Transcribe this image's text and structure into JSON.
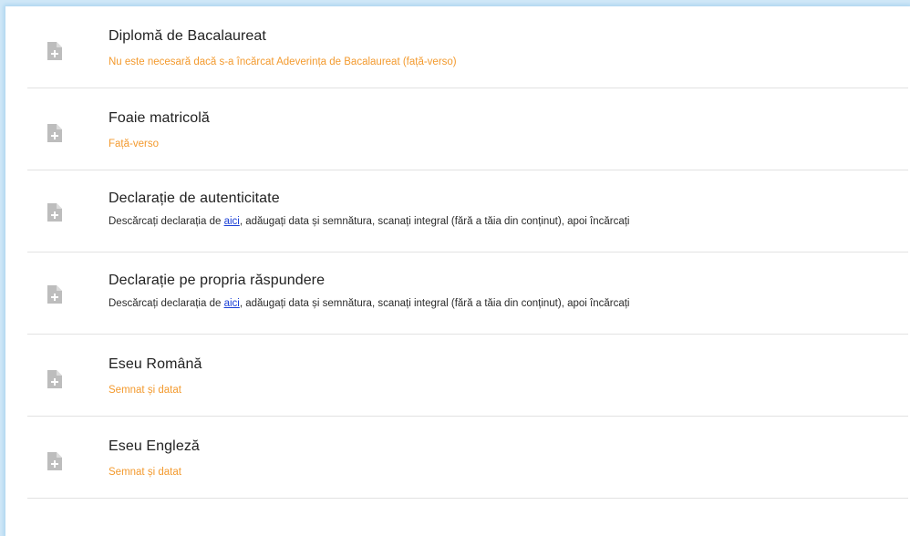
{
  "documents": [
    {
      "title": "Diplomă de Bacalaureat",
      "subtitle": "Nu este necesară dacă s-a încărcat Adeverința de Bacalaureat (față-verso)",
      "subtitle_color": "#f39a2e",
      "icon": "file-add-icon"
    },
    {
      "title": "Foaie matricolă",
      "subtitle": "Față-verso",
      "subtitle_color": "#f39a2e",
      "icon": "file-add-icon"
    },
    {
      "title": "Declarație de autenticitate",
      "subtitle_before": "Descărcați declarația de ",
      "subtitle_link": "aici",
      "subtitle_after": ", adăugați data și semnătura, scanați integral (fără a tăia din conținut), apoi încărcați",
      "icon": "file-add-icon"
    },
    {
      "title": "Declarație pe propria răspundere",
      "subtitle_before": "Descărcați declarația de ",
      "subtitle_link": "aici",
      "subtitle_after": ", adăugați data și semnătura, scanați integral (fără a tăia din conținut), apoi încărcați",
      "icon": "file-add-icon"
    },
    {
      "title": "Eseu Română",
      "subtitle": "Semnat și datat",
      "subtitle_color": "#f39a2e",
      "icon": "file-add-icon"
    },
    {
      "title": "Eseu Engleză",
      "subtitle": "Semnat și datat",
      "subtitle_color": "#f39a2e",
      "icon": "file-add-icon"
    }
  ],
  "colors": {
    "accent_orange": "#f39a2e",
    "link_blue": "#1a3fd6",
    "divider": "#e2e2e2",
    "icon_gray": "#bdbdbd"
  }
}
